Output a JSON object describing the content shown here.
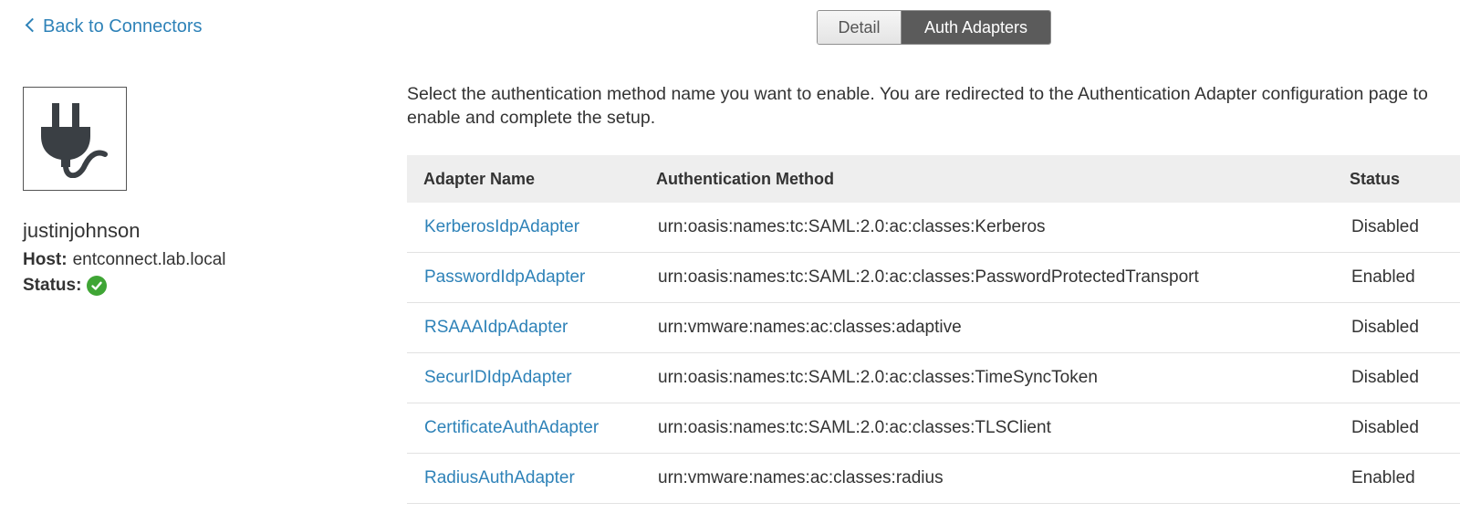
{
  "nav": {
    "back_label": "Back to Connectors"
  },
  "tabs": [
    {
      "label": "Detail",
      "active": false
    },
    {
      "label": "Auth Adapters",
      "active": true
    }
  ],
  "connector": {
    "icon": "plug-icon",
    "name": "justinjohnson",
    "host_label": "Host:",
    "host_value": "entconnect.lab.local",
    "status_label": "Status:",
    "status_icon": "check-circle-icon",
    "status_color": "#3fa535"
  },
  "description": "Select the authentication method name you want to enable. You are redirected to the Authentication Adapter configuration page to enable and complete the setup.",
  "table": {
    "headers": {
      "name": "Adapter Name",
      "method": "Authentication Method",
      "status": "Status"
    },
    "rows": [
      {
        "name": "KerberosIdpAdapter",
        "method": "urn:oasis:names:tc:SAML:2.0:ac:classes:Kerberos",
        "status": "Disabled"
      },
      {
        "name": "PasswordIdpAdapter",
        "method": "urn:oasis:names:tc:SAML:2.0:ac:classes:PasswordProtectedTransport",
        "status": "Enabled"
      },
      {
        "name": "RSAAAIdpAdapter",
        "method": "urn:vmware:names:ac:classes:adaptive",
        "status": "Disabled"
      },
      {
        "name": "SecurIDIdpAdapter",
        "method": "urn:oasis:names:tc:SAML:2.0:ac:classes:TimeSyncToken",
        "status": "Disabled"
      },
      {
        "name": "CertificateAuthAdapter",
        "method": "urn:oasis:names:tc:SAML:2.0:ac:classes:TLSClient",
        "status": "Disabled"
      },
      {
        "name": "RadiusAuthAdapter",
        "method": "urn:vmware:names:ac:classes:radius",
        "status": "Enabled"
      }
    ]
  },
  "colors": {
    "link": "#2e82b8",
    "active_tab": "#5b5b5b",
    "header_bg": "#eeeeee"
  }
}
